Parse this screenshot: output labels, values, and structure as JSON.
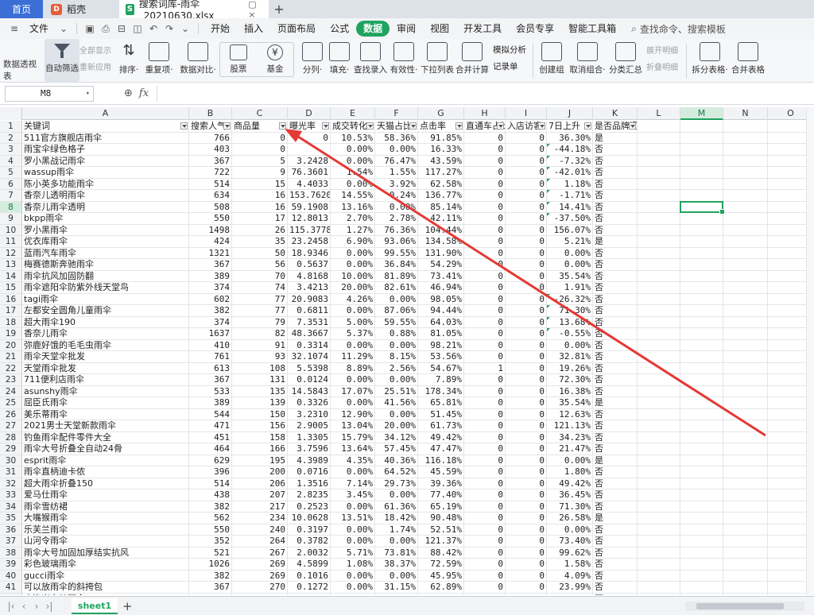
{
  "tabs": {
    "home": "首页",
    "doc": "稻壳",
    "doc_icon": "D",
    "file": "搜索词库-雨伞_20210630.xlsx",
    "file_icon": "S",
    "close": "▢ ×",
    "plus": "+"
  },
  "menu": {
    "file": "文件",
    "items": [
      "开始",
      "插入",
      "页面布局",
      "公式",
      "数据",
      "审阅",
      "视图",
      "开发工具",
      "会员专享",
      "智能工具箱"
    ],
    "active_index": 4,
    "search": "查找命令、搜索模板"
  },
  "ribbon": {
    "pivot": "数据透视表",
    "autofilter": "自动筛选",
    "show_all": "全部显示",
    "reapply": "重新应用",
    "sort": "排序·",
    "duplicates": "重复项·",
    "compare": "数据对比·",
    "stock": "股票",
    "fund": "基金",
    "split": "分列·",
    "fill": "填充·",
    "lookup": "查找录入",
    "validity": "有效性·",
    "dropdown": "下拉列表",
    "consolidate": "合并计算",
    "simulate": "模拟分析",
    "record": "记录单",
    "group": "创建组",
    "ungroup": "取消组合·",
    "subtotal": "分类汇总",
    "expand": "展开明细",
    "collapse": "折叠明细",
    "split_table": "拆分表格·",
    "merge_table": "合并表格"
  },
  "formula": {
    "cell_ref": "M8",
    "zoom_icon": "⊕",
    "fx": "fx",
    "value": ""
  },
  "columns": [
    "A",
    "B",
    "C",
    "D",
    "E",
    "F",
    "G",
    "H",
    "I",
    "J",
    "K",
    "L",
    "M",
    "N",
    "O"
  ],
  "selected_cell": {
    "col": "M",
    "row": 8
  },
  "header_row": [
    "关键词",
    "搜索人气",
    "商品量",
    "曝光率",
    "成交转化",
    "天猫占比",
    "点击率",
    "直通车占比",
    "入店访客",
    "7日上升",
    "是否品牌词"
  ],
  "rows": [
    {
      "n": 2,
      "c": [
        "511官方旗舰店雨伞",
        "766",
        "0",
        "0",
        "10.53%",
        "58.36%",
        "91.85%",
        "0",
        "0",
        "36.30%",
        "是"
      ]
    },
    {
      "n": 3,
      "c": [
        "雨宝伞绿色格子",
        "403",
        "0",
        "",
        "0.00%",
        "0.00%",
        "16.33%",
        "0",
        "0",
        "-44.18%",
        "否"
      ]
    },
    {
      "n": 4,
      "c": [
        "罗小黑战记雨伞",
        "367",
        "5",
        "3.2428",
        "0.00%",
        "76.47%",
        "43.59%",
        "0",
        "0",
        "-7.32%",
        "否"
      ]
    },
    {
      "n": 5,
      "c": [
        "wassup雨伞",
        "722",
        "9",
        "76.3601",
        "1.54%",
        "1.55%",
        "117.27%",
        "0",
        "0",
        "-42.01%",
        "否"
      ]
    },
    {
      "n": 6,
      "c": [
        "陈小英多功能雨伞",
        "514",
        "15",
        "4.4033",
        "0.00%",
        "3.92%",
        "62.58%",
        "0",
        "0",
        "1.18%",
        "否"
      ]
    },
    {
      "n": 7,
      "c": [
        "香奈儿透明雨伞",
        "634",
        "16",
        "153.7620",
        "14.55%",
        "0.24%",
        "136.77%",
        "0",
        "0",
        "-1.71%",
        "否"
      ]
    },
    {
      "n": 8,
      "c": [
        "香奈儿雨伞透明",
        "508",
        "16",
        "59.1908",
        "13.16%",
        "0.00%",
        "85.14%",
        "0",
        "0",
        "14.41%",
        "否"
      ]
    },
    {
      "n": 9,
      "c": [
        "bkpp雨伞",
        "550",
        "17",
        "12.8013",
        "2.70%",
        "2.78%",
        "42.11%",
        "0",
        "0",
        "-37.50%",
        "否"
      ]
    },
    {
      "n": 10,
      "c": [
        "罗小黑雨伞",
        "1498",
        "26",
        "115.3778",
        "1.27%",
        "76.36%",
        "104.44%",
        "0",
        "0",
        "156.07%",
        "否"
      ]
    },
    {
      "n": 11,
      "c": [
        "优衣库雨伞",
        "424",
        "35",
        "23.2458",
        "6.90%",
        "93.06%",
        "134.58%",
        "0",
        "0",
        "5.21%",
        "是"
      ]
    },
    {
      "n": 12,
      "c": [
        "蓝雨汽车雨伞",
        "1321",
        "50",
        "18.9346",
        "0.00%",
        "99.55%",
        "131.90%",
        "0",
        "0",
        "0.00%",
        "否"
      ]
    },
    {
      "n": 13,
      "c": [
        "梅赛德斯奔驰雨伞",
        "367",
        "56",
        "0.5637",
        "0.00%",
        "36.84%",
        "54.29%",
        "0",
        "0",
        "0.00%",
        "否"
      ]
    },
    {
      "n": 14,
      "c": [
        "雨伞抗风加固防翻",
        "389",
        "70",
        "4.8168",
        "10.00%",
        "81.89%",
        "73.41%",
        "0",
        "0",
        "35.54%",
        "否"
      ]
    },
    {
      "n": 15,
      "c": [
        "雨伞遮阳伞防紫外线天堂鸟",
        "374",
        "74",
        "3.4213",
        "20.00%",
        "82.61%",
        "46.94%",
        "0",
        "0",
        "1.91%",
        "否"
      ]
    },
    {
      "n": 16,
      "c": [
        "tagi雨伞",
        "602",
        "77",
        "20.9083",
        "4.26%",
        "0.00%",
        "98.05%",
        "0",
        "0",
        "-26.32%",
        "否"
      ]
    },
    {
      "n": 17,
      "c": [
        "左都安全圆角儿童雨伞",
        "382",
        "77",
        "0.6811",
        "0.00%",
        "87.06%",
        "94.44%",
        "0",
        "0",
        "71.30%",
        "否"
      ]
    },
    {
      "n": 18,
      "c": [
        "超大雨伞190",
        "374",
        "79",
        "7.3531",
        "5.00%",
        "59.55%",
        "64.03%",
        "0",
        "0",
        "13.68%",
        "否"
      ]
    },
    {
      "n": 19,
      "c": [
        "香奈儿雨伞",
        "1637",
        "82",
        "48.3667",
        "5.37%",
        "0.88%",
        "81.05%",
        "0",
        "0",
        "-0.55%",
        "否"
      ]
    },
    {
      "n": 20,
      "c": [
        "弥鹿好饿的毛毛虫雨伞",
        "410",
        "91",
        "0.3314",
        "0.00%",
        "0.00%",
        "98.21%",
        "0",
        "0",
        "0.00%",
        "否"
      ]
    },
    {
      "n": 21,
      "c": [
        "雨伞天堂伞批发",
        "761",
        "93",
        "32.1074",
        "11.29%",
        "8.15%",
        "53.56%",
        "0",
        "0",
        "32.81%",
        "否"
      ]
    },
    {
      "n": 22,
      "c": [
        "天堂雨伞批发",
        "613",
        "108",
        "5.5398",
        "8.89%",
        "2.56%",
        "54.67%",
        "1",
        "0",
        "19.26%",
        "否"
      ]
    },
    {
      "n": 23,
      "c": [
        "711便利店雨伞",
        "367",
        "131",
        "0.0124",
        "0.00%",
        "0.00%",
        "7.89%",
        "0",
        "0",
        "72.30%",
        "否"
      ]
    },
    {
      "n": 24,
      "c": [
        "asunshy雨伞",
        "533",
        "135",
        "14.5843",
        "17.07%",
        "25.51%",
        "178.34%",
        "0",
        "0",
        "16.38%",
        "否"
      ]
    },
    {
      "n": 25,
      "c": [
        "屈臣氏雨伞",
        "389",
        "139",
        "0.3326",
        "0.00%",
        "41.56%",
        "65.81%",
        "0",
        "0",
        "35.54%",
        "是"
      ]
    },
    {
      "n": 26,
      "c": [
        "美乐蒂雨伞",
        "544",
        "150",
        "3.2310",
        "12.90%",
        "0.00%",
        "51.45%",
        "0",
        "0",
        "12.63%",
        "否"
      ]
    },
    {
      "n": 27,
      "c": [
        "2021男士天堂新款雨伞",
        "471",
        "156",
        "2.9005",
        "13.04%",
        "20.00%",
        "61.73%",
        "0",
        "0",
        "121.13%",
        "否"
      ]
    },
    {
      "n": 28,
      "c": [
        "钓鱼雨伞配件零件大全",
        "451",
        "158",
        "1.3305",
        "15.79%",
        "34.12%",
        "49.42%",
        "0",
        "0",
        "34.23%",
        "否"
      ]
    },
    {
      "n": 29,
      "c": [
        "雨伞大号折叠全自动24骨",
        "464",
        "166",
        "3.7596",
        "13.64%",
        "57.45%",
        "47.47%",
        "0",
        "0",
        "21.47%",
        "否"
      ]
    },
    {
      "n": 30,
      "c": [
        "esprit雨伞",
        "629",
        "195",
        "4.3989",
        "4.35%",
        "40.36%",
        "116.18%",
        "0",
        "0",
        "0.00%",
        "是"
      ]
    },
    {
      "n": 31,
      "c": [
        "雨伞直柄迪卡侬",
        "396",
        "200",
        "0.0716",
        "0.00%",
        "64.52%",
        "45.59%",
        "0",
        "0",
        "1.80%",
        "否"
      ]
    },
    {
      "n": 32,
      "c": [
        "超大雨伞折叠150",
        "514",
        "206",
        "1.3516",
        "7.14%",
        "29.73%",
        "39.36%",
        "0",
        "0",
        "49.42%",
        "否"
      ]
    },
    {
      "n": 33,
      "c": [
        "爱马仕雨伞",
        "438",
        "207",
        "2.8235",
        "3.45%",
        "0.00%",
        "77.40%",
        "0",
        "0",
        "36.45%",
        "否"
      ]
    },
    {
      "n": 34,
      "c": [
        "雨伞雪纺裙",
        "382",
        "217",
        "0.2523",
        "0.00%",
        "61.36%",
        "65.19%",
        "0",
        "0",
        "71.30%",
        "否"
      ]
    },
    {
      "n": 35,
      "c": [
        "大嘴猴雨伞",
        "562",
        "234",
        "10.0628",
        "13.51%",
        "18.42%",
        "90.48%",
        "0",
        "0",
        "26.58%",
        "是"
      ]
    },
    {
      "n": 36,
      "c": [
        "乐芙兰雨伞",
        "550",
        "240",
        "0.3197",
        "0.00%",
        "1.74%",
        "52.51%",
        "0",
        "0",
        "0.00%",
        "否"
      ]
    },
    {
      "n": 37,
      "c": [
        "山河令雨伞",
        "352",
        "264",
        "0.3782",
        "0.00%",
        "0.00%",
        "121.37%",
        "0",
        "0",
        "73.40%",
        "否"
      ]
    },
    {
      "n": 38,
      "c": [
        "雨伞大号加固加厚结实抗风",
        "521",
        "267",
        "2.0032",
        "5.71%",
        "73.81%",
        "88.42%",
        "0",
        "0",
        "99.62%",
        "否"
      ]
    },
    {
      "n": 39,
      "c": [
        "彩色玻璃雨伞",
        "1026",
        "269",
        "4.5899",
        "1.08%",
        "38.37%",
        "72.59%",
        "0",
        "0",
        "1.58%",
        "否"
      ]
    },
    {
      "n": 40,
      "c": [
        "gucci雨伞",
        "382",
        "269",
        "0.1016",
        "0.00%",
        "0.00%",
        "45.95%",
        "0",
        "0",
        "4.09%",
        "否"
      ]
    },
    {
      "n": 41,
      "c": [
        "可以放雨伞的斜挎包",
        "367",
        "270",
        "0.1272",
        "0.00%",
        "31.15%",
        "62.89%",
        "0",
        "0",
        "23.99%",
        "否"
      ]
    },
    {
      "n": 42,
      "c": [
        "底资米自动雨伞",
        "747",
        "275",
        "1.8799",
        "0.00%",
        "3.90%",
        "69.10%",
        "0",
        "0",
        "0.00%",
        "否"
      ]
    }
  ],
  "green_marks_rows": [
    3,
    4,
    5,
    6,
    7,
    8,
    9,
    16,
    17,
    18,
    19
  ],
  "sheet_tab": "sheet1",
  "sheet_add": "+",
  "annotation_color": "#e53935"
}
